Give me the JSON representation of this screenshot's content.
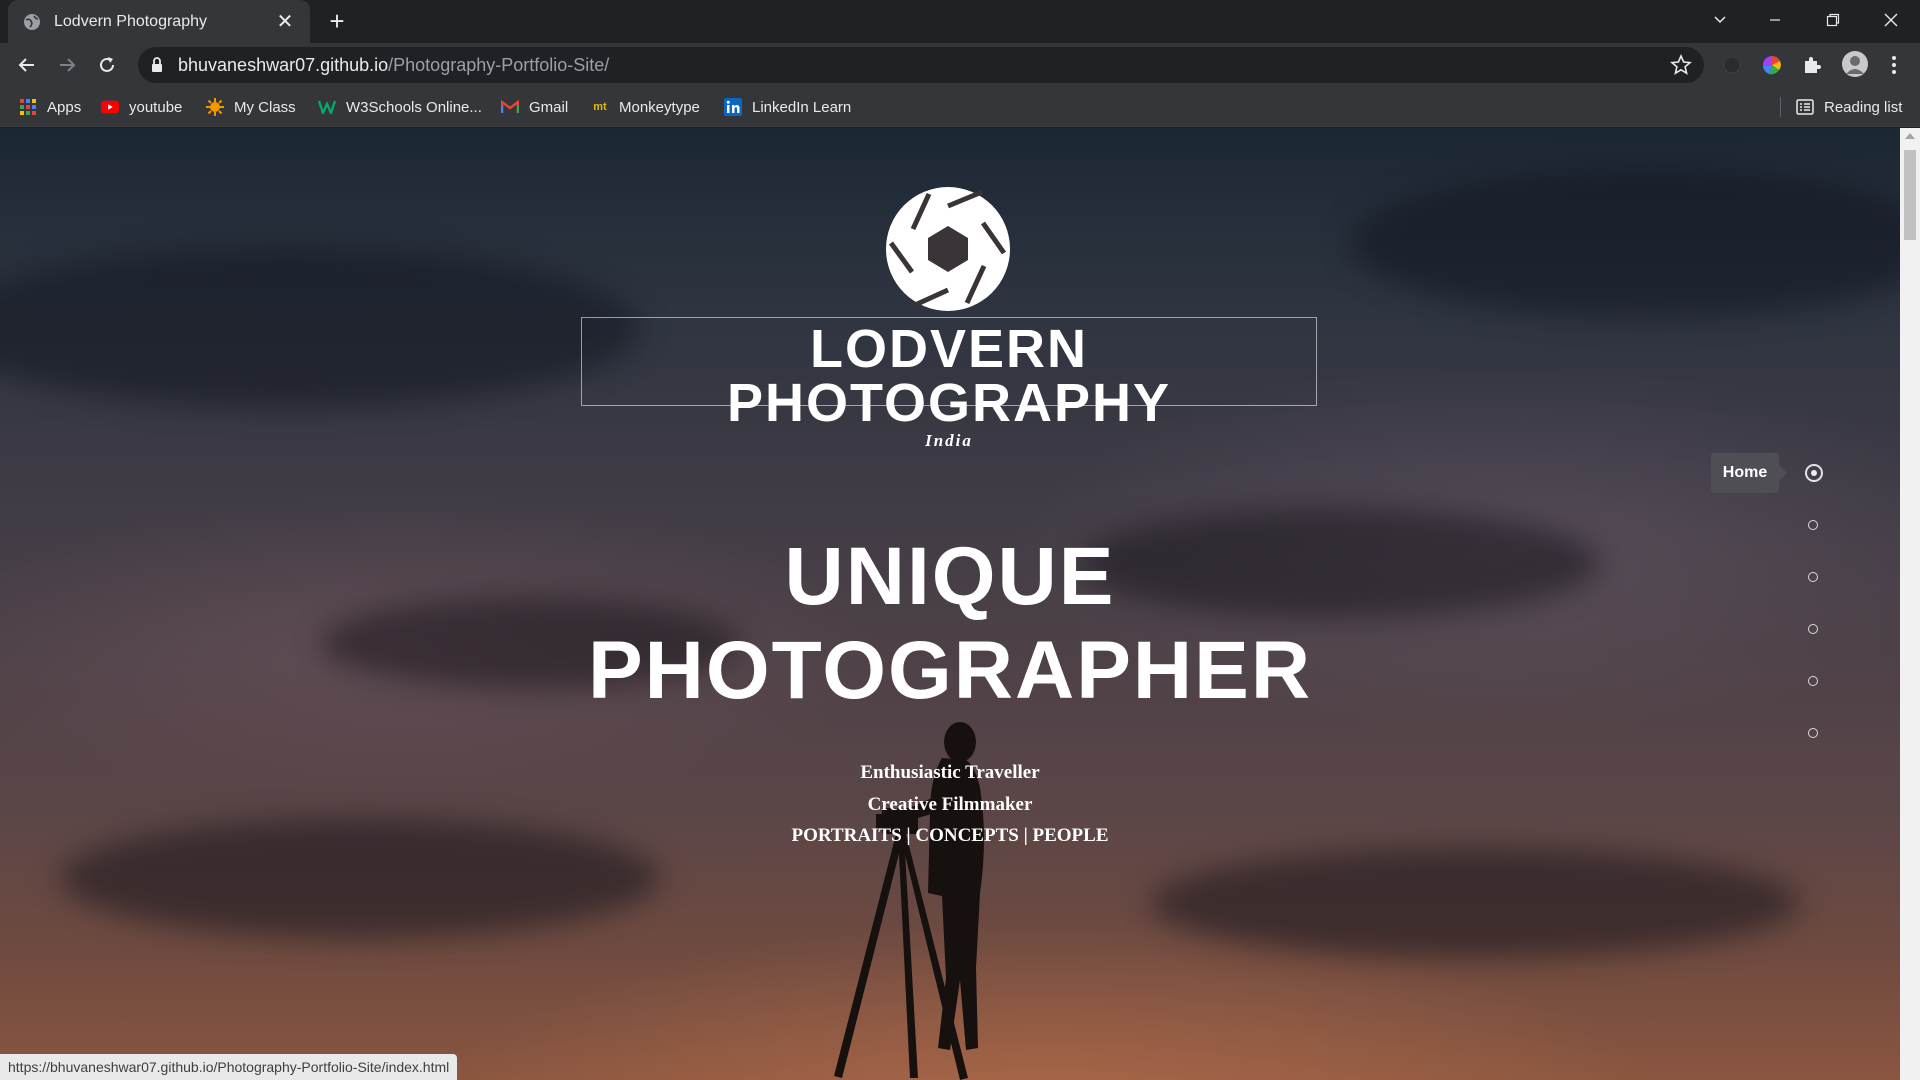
{
  "browser": {
    "tab": {
      "title": "Lodvern Photography",
      "close_glyph": "✕"
    },
    "new_tab_glyph": "+",
    "address": {
      "host": "bhuvaneshwar07.github.io",
      "path": "/Photography-Portfolio-Site/"
    },
    "bookmarks": [
      {
        "label": "Apps",
        "icon": "apps-grid-icon"
      },
      {
        "label": "youtube",
        "icon": "youtube-icon"
      },
      {
        "label": "My Class",
        "icon": "myclass-icon"
      },
      {
        "label": "W3Schools Online...",
        "icon": "w3schools-icon"
      },
      {
        "label": "Gmail",
        "icon": "gmail-icon"
      },
      {
        "label": "Monkeytype",
        "icon": "monkeytype-icon"
      },
      {
        "label": "LinkedIn Learn",
        "icon": "linkedin-icon"
      }
    ],
    "reading_list": "Reading list",
    "status_url": "https://bhuvaneshwar07.github.io/Photography-Portfolio-Site/index.html"
  },
  "site": {
    "brand": "LODVERN PHOTOGRAPHY",
    "country": "India",
    "hero_line1": "UNIQUE",
    "hero_line2": "PHOTOGRAPHER",
    "tagline1": "Enthusiastic Traveller",
    "tagline2": "Creative Filmmaker",
    "tagline3": "PORTRAITS | CONCEPTS | PEOPLE",
    "side_nav_tooltip": "Home",
    "side_nav_count": 6,
    "side_nav_active_index": 0
  },
  "colors": {
    "chrome_dark": "#202124",
    "chrome_toolbar": "#35363a",
    "text_light": "#e8eaed",
    "hero_text": "#ffffff"
  }
}
